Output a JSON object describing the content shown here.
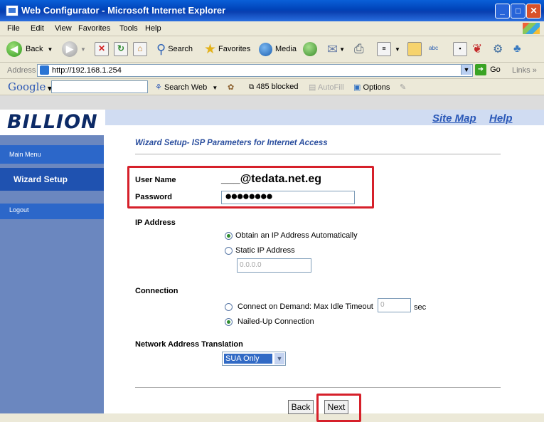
{
  "window": {
    "title": "Web Configurator - Microsoft Internet Explorer",
    "controls": {
      "minimize": "_",
      "maximize": "□",
      "close": "✕"
    }
  },
  "menubar": {
    "items": [
      "File",
      "Edit",
      "View",
      "Favorites",
      "Tools",
      "Help"
    ]
  },
  "toolbar": {
    "back_label": "Back",
    "search_label": "Search",
    "favorites_label": "Favorites",
    "media_label": "Media"
  },
  "addressbar": {
    "label": "Address",
    "url": "http://192.168.1.254",
    "go_label": "Go",
    "links_label": "Links"
  },
  "googlebar": {
    "logo": "Google",
    "search_web": "Search Web",
    "blocked": "485 blocked",
    "autofill": "AutoFill",
    "options": "Options"
  },
  "page": {
    "brand": "BILLION",
    "top_links": {
      "site_map": "Site Map",
      "help": "Help"
    },
    "sidebar": {
      "main_menu": "Main Menu",
      "wizard_setup": "Wizard Setup",
      "logout": "Logout"
    },
    "wizard_title": "Wizard Setup- ISP Parameters for Internet Access",
    "user_name_label": "User Name",
    "user_name_value": "___@tedata.net.eg",
    "password_label": "Password",
    "password_value": "●●●●●●●●",
    "ip_section_label": "IP Address",
    "ip_options": {
      "auto": "Obtain an IP Address Automatically",
      "static": "Static IP Address",
      "selected": "auto"
    },
    "static_ip_placeholder": "0.0.0.0",
    "connection_label": "Connection",
    "connection_options": {
      "on_demand": "Connect on Demand: Max Idle Timeout",
      "nailed_up": "Nailed-Up Connection",
      "selected": "nailed_up"
    },
    "idle_timeout_value": "0",
    "idle_timeout_unit": "sec",
    "nat_label": "Network Address Translation",
    "nat_selected": "SUA Only",
    "back_button": "Back",
    "next_button": "Next"
  },
  "colors": {
    "highlight_box": "#d6202a",
    "sidebar_item": "#2c67c9",
    "link": "#2a58b8",
    "brand": "#0c2a66"
  }
}
